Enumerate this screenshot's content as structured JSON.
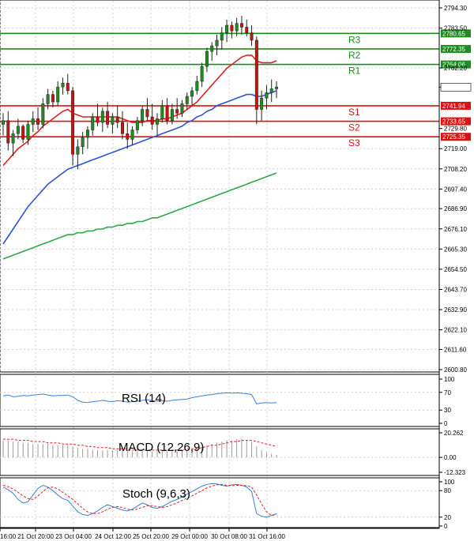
{
  "colors": {
    "up": "#1e8c1e",
    "down": "#cc1111",
    "resistance": "#1e8c1e",
    "support": "#dd1111",
    "ma_fast": "#e02020",
    "ma_mid": "#2b54d8",
    "ma_slow": "#2ea64a",
    "indicator": "#3a7fd8",
    "grid": "#d0d0d0",
    "axis": "#000000",
    "last_price_bg": "#ffffff"
  },
  "chart_data": [
    {
      "type": "candlestick",
      "panel": "price",
      "y_ticks": [
        "2794.30",
        "2783.50",
        "2762.20",
        "2751.93",
        "2719.00",
        "2708.20",
        "2697.40",
        "2686.90",
        "2676.10",
        "2665.30",
        "2654.50",
        "2643.70",
        "2632.90",
        "2622.10",
        "2611.60",
        "2600.80",
        "2729.80"
      ],
      "ylim": [
        2600.8,
        2794.3
      ],
      "grid": true,
      "last_price": "2751.93",
      "levels": [
        {
          "name": "R3",
          "value": 2780.65,
          "label": "2780.65",
          "kind": "resistance"
        },
        {
          "name": "R2",
          "value": 2772.35,
          "label": "2772.35",
          "kind": "resistance"
        },
        {
          "name": "R1",
          "value": 2764.06,
          "label": "2764.06",
          "kind": "resistance"
        },
        {
          "name": "S1",
          "value": 2741.94,
          "label": "2741.94",
          "kind": "support"
        },
        {
          "name": "S2",
          "value": 2733.65,
          "label": "2733.65",
          "kind": "support"
        },
        {
          "name": "S3",
          "value": 2725.35,
          "label": "2725.35",
          "kind": "support"
        }
      ],
      "candles": [
        [
          2732,
          2738,
          2726,
          2734
        ],
        [
          2734,
          2739,
          2718,
          2722
        ],
        [
          2722,
          2729,
          2715,
          2727
        ],
        [
          2727,
          2735,
          2724,
          2731
        ],
        [
          2731,
          2732,
          2722,
          2724
        ],
        [
          2724,
          2734,
          2721,
          2732
        ],
        [
          2732,
          2739,
          2728,
          2735
        ],
        [
          2735,
          2741,
          2729,
          2732
        ],
        [
          2732,
          2746,
          2730,
          2743
        ],
        [
          2743,
          2751,
          2740,
          2748
        ],
        [
          2748,
          2750,
          2741,
          2744
        ],
        [
          2744,
          2755,
          2742,
          2752
        ],
        [
          2752,
          2757,
          2748,
          2754
        ],
        [
          2754,
          2759,
          2748,
          2750
        ],
        [
          2750,
          2752,
          2710,
          2716
        ],
        [
          2716,
          2724,
          2708,
          2720
        ],
        [
          2720,
          2728,
          2716,
          2725
        ],
        [
          2725,
          2731,
          2719,
          2729
        ],
        [
          2729,
          2738,
          2726,
          2736
        ],
        [
          2736,
          2743,
          2731,
          2733
        ],
        [
          2733,
          2741,
          2728,
          2739
        ],
        [
          2739,
          2744,
          2730,
          2732
        ],
        [
          2732,
          2738,
          2727,
          2736
        ],
        [
          2736,
          2742,
          2730,
          2733
        ],
        [
          2733,
          2739,
          2724,
          2727
        ],
        [
          2727,
          2733,
          2719,
          2724
        ],
        [
          2724,
          2731,
          2721,
          2729
        ],
        [
          2729,
          2736,
          2727,
          2734
        ],
        [
          2734,
          2742,
          2731,
          2740
        ],
        [
          2740,
          2746,
          2734,
          2736
        ],
        [
          2736,
          2743,
          2729,
          2732
        ],
        [
          2732,
          2738,
          2726,
          2735
        ],
        [
          2735,
          2745,
          2733,
          2742
        ],
        [
          2742,
          2746,
          2732,
          2734
        ],
        [
          2734,
          2743,
          2732,
          2740
        ],
        [
          2740,
          2746,
          2735,
          2738
        ],
        [
          2738,
          2745,
          2736,
          2743
        ],
        [
          2743,
          2749,
          2740,
          2747
        ],
        [
          2747,
          2752,
          2742,
          2750
        ],
        [
          2750,
          2758,
          2748,
          2755
        ],
        [
          2755,
          2765,
          2752,
          2763
        ],
        [
          2763,
          2773,
          2760,
          2771
        ],
        [
          2771,
          2776,
          2766,
          2774
        ],
        [
          2774,
          2780,
          2769,
          2777
        ],
        [
          2777,
          2784,
          2772,
          2781
        ],
        [
          2781,
          2788,
          2776,
          2785
        ],
        [
          2785,
          2787,
          2778,
          2782
        ],
        [
          2782,
          2789,
          2779,
          2786
        ],
        [
          2786,
          2790,
          2780,
          2784
        ],
        [
          2784,
          2788,
          2779,
          2781
        ],
        [
          2781,
          2785,
          2774,
          2777
        ],
        [
          2777,
          2779,
          2732,
          2740
        ],
        [
          2740,
          2750,
          2734,
          2746
        ],
        [
          2746,
          2753,
          2740,
          2749
        ],
        [
          2749,
          2756,
          2744,
          2751
        ],
        [
          2751,
          2755,
          2746,
          2752
        ]
      ],
      "ma_fast": [
        2710,
        2713,
        2716,
        2719,
        2721,
        2723,
        2726,
        2728,
        2731,
        2733,
        2735,
        2737,
        2739,
        2740,
        2738,
        2737,
        2736,
        2736,
        2736,
        2736,
        2736,
        2736,
        2736,
        2736,
        2735,
        2734,
        2733,
        2733,
        2733,
        2734,
        2734,
        2734,
        2735,
        2735,
        2736,
        2737,
        2738,
        2740,
        2742,
        2744,
        2747,
        2750,
        2753,
        2756,
        2759,
        2762,
        2764,
        2766,
        2768,
        2769,
        2769,
        2766,
        2765,
        2765,
        2765,
        2766
      ],
      "ma_mid": [
        2668,
        2672,
        2676,
        2680,
        2684,
        2688,
        2691,
        2694,
        2697,
        2700,
        2702,
        2704,
        2706,
        2708,
        2709,
        2710,
        2711,
        2712,
        2713,
        2714,
        2715,
        2716,
        2717,
        2718,
        2719,
        2720,
        2721,
        2722,
        2723,
        2724,
        2725,
        2726,
        2727,
        2728,
        2729,
        2730,
        2731,
        2733,
        2734,
        2736,
        2737,
        2739,
        2740,
        2742,
        2743,
        2744,
        2745,
        2746,
        2747,
        2748,
        2748,
        2747,
        2747,
        2748,
        2749,
        2750
      ],
      "ma_slow": [
        2660,
        2661,
        2662,
        2663,
        2664,
        2665,
        2666,
        2667,
        2668,
        2669,
        2670,
        2671,
        2672,
        2673,
        2673,
        2674,
        2674,
        2675,
        2675,
        2676,
        2676,
        2677,
        2677,
        2678,
        2678,
        2679,
        2679,
        2680,
        2680,
        2681,
        2682,
        2682,
        2683,
        2684,
        2685,
        2686,
        2687,
        2688,
        2689,
        2690,
        2691,
        2692,
        2693,
        2694,
        2695,
        2696,
        2697,
        2698,
        2699,
        2700,
        2701,
        2702,
        2703,
        2704,
        2705,
        2706
      ]
    },
    {
      "type": "line",
      "panel": "rsi",
      "title": "RSI (14)",
      "y_ticks": [
        "100",
        "70",
        "30",
        "0"
      ],
      "ylim": [
        0,
        100
      ],
      "values": [
        62,
        64,
        60,
        61,
        63,
        62,
        64,
        65,
        66,
        64,
        62,
        63,
        63,
        64,
        60,
        52,
        48,
        47,
        49,
        50,
        52,
        50,
        49,
        51,
        50,
        48,
        49,
        50,
        52,
        53,
        51,
        50,
        51,
        50,
        52,
        53,
        54,
        55,
        58,
        60,
        62,
        64,
        65,
        67,
        68,
        69,
        68,
        69,
        68,
        67,
        65,
        44,
        46,
        47,
        46,
        47
      ]
    },
    {
      "type": "bar",
      "panel": "macd",
      "title": "MACD (12,26,9)",
      "y_ticks": [
        "20.262",
        "0.00",
        "-12.323"
      ],
      "ylim": [
        -12.323,
        20.262
      ],
      "histogram": [
        14,
        14,
        13,
        13,
        12,
        12,
        11,
        11,
        11,
        11,
        10,
        10,
        10,
        10,
        9,
        8,
        7,
        7,
        6,
        6,
        6,
        6,
        6,
        6,
        6,
        6,
        5,
        5,
        5,
        5,
        5,
        5,
        5,
        5,
        5,
        5,
        6,
        6,
        7,
        8,
        9,
        10,
        11,
        12,
        13,
        14,
        14,
        15,
        15,
        14,
        13,
        9,
        6,
        4,
        3,
        2
      ],
      "signal": [
        15,
        15,
        15,
        14,
        14,
        14,
        13,
        13,
        13,
        12,
        12,
        12,
        11,
        11,
        11,
        10,
        10,
        9,
        9,
        8,
        8,
        8,
        7,
        7,
        7,
        7,
        6,
        6,
        6,
        6,
        6,
        6,
        6,
        6,
        6,
        6,
        6,
        7,
        7,
        7,
        8,
        9,
        10,
        10,
        11,
        12,
        13,
        13,
        14,
        14,
        14,
        13,
        12,
        11,
        10,
        9
      ]
    },
    {
      "type": "line",
      "panel": "stoch",
      "title": "Stoch (9,6,3)",
      "y_ticks": [
        "100",
        "80",
        "20",
        "0"
      ],
      "ylim": [
        0,
        100
      ],
      "k": [
        88,
        82,
        74,
        60,
        52,
        55,
        70,
        85,
        92,
        88,
        80,
        70,
        62,
        58,
        45,
        32,
        26,
        24,
        28,
        34,
        42,
        48,
        44,
        40,
        36,
        34,
        38,
        45,
        52,
        48,
        42,
        40,
        44,
        50,
        56,
        60,
        66,
        72,
        78,
        84,
        90,
        94,
        96,
        95,
        92,
        90,
        93,
        94,
        92,
        88,
        78,
        28,
        22,
        20,
        24,
        28
      ],
      "d": [
        92,
        89,
        84,
        76,
        68,
        62,
        60,
        68,
        78,
        86,
        88,
        84,
        76,
        68,
        60,
        50,
        40,
        32,
        28,
        28,
        32,
        38,
        42,
        44,
        42,
        38,
        36,
        38,
        42,
        46,
        46,
        44,
        42,
        44,
        48,
        52,
        58,
        63,
        68,
        74,
        80,
        86,
        90,
        93,
        94,
        92,
        91,
        92,
        92,
        91,
        88,
        70,
        50,
        32,
        24,
        26
      ]
    }
  ],
  "x_axis_labels": [
    "16:00",
    "21 Oct 20:00",
    "23 Oct 04:00",
    "24 Oct 12:00",
    "25 Oct 20:00",
    "29 Oct 00:00",
    "30 Oct 08:00",
    "31 Oct 16:00"
  ]
}
